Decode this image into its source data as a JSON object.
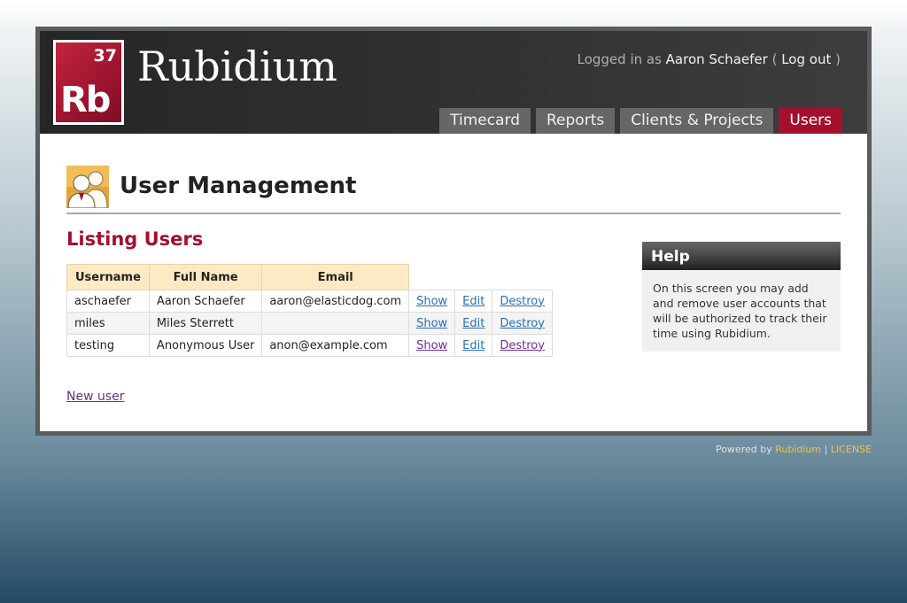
{
  "logo": {
    "number": "37",
    "symbol": "Rb"
  },
  "app_title": "Rubidium",
  "user_bar": {
    "prefix": "Logged in as",
    "user_name": "Aaron Schaefer",
    "open_paren": "(",
    "logout_label": "Log out",
    "close_paren": ")"
  },
  "tabs": [
    {
      "label": "Timecard",
      "active": false
    },
    {
      "label": "Reports",
      "active": false
    },
    {
      "label": "Clients & Projects",
      "active": false
    },
    {
      "label": "Users",
      "active": true
    }
  ],
  "page": {
    "icon": "users-icon",
    "title": "User Management",
    "section_title": "Listing Users"
  },
  "table": {
    "headers": [
      "Username",
      "Full Name",
      "Email"
    ],
    "rows": [
      {
        "username": "aschaefer",
        "full_name": "Aaron Schaefer",
        "email": "aaron@elasticdog.com",
        "show": "Show",
        "edit": "Edit",
        "destroy": "Destroy"
      },
      {
        "username": "miles",
        "full_name": "Miles Sterrett",
        "email": "",
        "show": "Show",
        "edit": "Edit",
        "destroy": "Destroy"
      },
      {
        "username": "testing",
        "full_name": "Anonymous User",
        "email": "anon@example.com",
        "show": "Show",
        "edit": "Edit",
        "destroy": "Destroy"
      }
    ]
  },
  "new_user_label": "New user",
  "help": {
    "title": "Help",
    "body": "On this screen you may add and remove user accounts that will be authorized to track their time using Rubidium."
  },
  "footer": {
    "prefix": "Powered by",
    "app_link": "Rubidium",
    "separator": "|",
    "license_link": "LICENSE"
  },
  "colors": {
    "accent": "#a3102e",
    "tab_inactive": "#666666",
    "table_header": "#fde9c4",
    "link": "#2a6fb8",
    "visited_link": "#6b2e8a",
    "footer_link": "#f0c14a"
  }
}
